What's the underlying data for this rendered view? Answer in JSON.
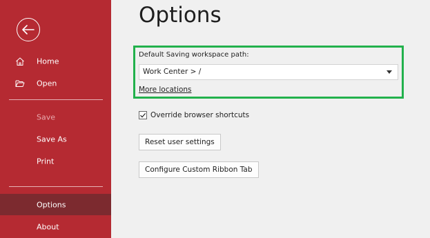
{
  "sidebar": {
    "back_icon": "arrow-left-icon",
    "items": [
      {
        "label": "Home",
        "icon": "home-icon"
      },
      {
        "label": "Open",
        "icon": "folder-open-icon"
      },
      {
        "label": "Save",
        "state": "disabled"
      },
      {
        "label": "Save As"
      },
      {
        "label": "Print"
      },
      {
        "label": "Options",
        "state": "selected"
      },
      {
        "label": "About"
      }
    ]
  },
  "main": {
    "title": "Options",
    "workspace": {
      "label": "Default Saving workspace path:",
      "selected_value": "Work Center > /",
      "more_link": "More locations"
    },
    "override_shortcuts": {
      "label": "Override browser shortcuts",
      "checked": true
    },
    "buttons": {
      "reset": "Reset user settings",
      "configure": "Configure Custom Ribbon Tab"
    }
  },
  "colors": {
    "sidebar_bg": "#b52a32",
    "sidebar_selected": "#7c2a2f",
    "content_bg": "#f0f0f0",
    "highlight": "#22b14c"
  }
}
